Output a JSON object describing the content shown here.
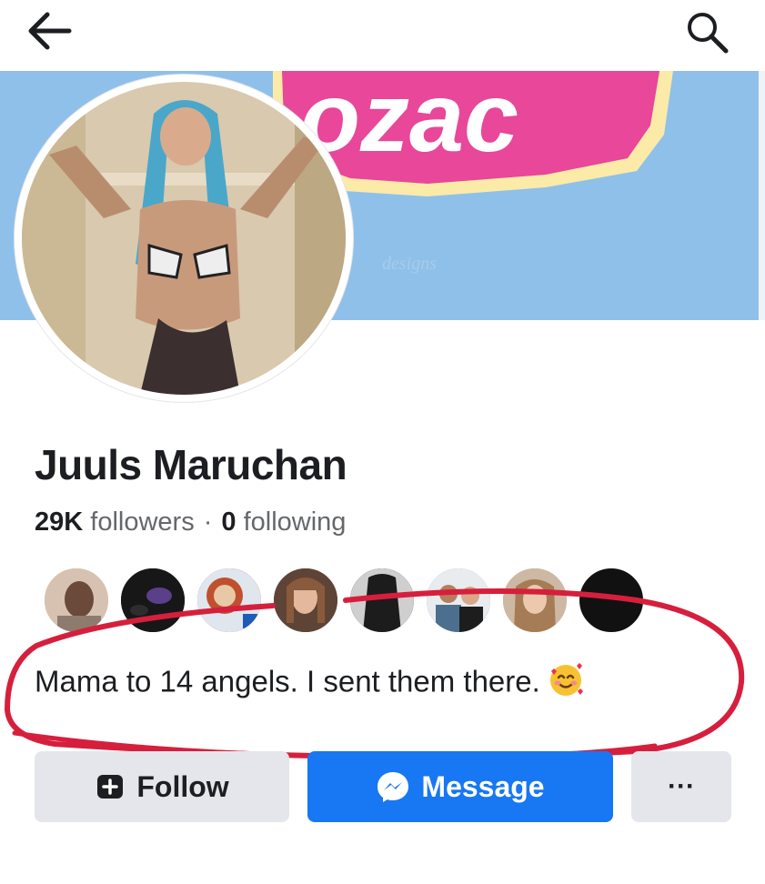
{
  "header": {
    "back_icon": "arrow-left-icon",
    "search_icon": "search-icon"
  },
  "cover": {
    "text": "ozac",
    "watermark": "designs",
    "background_color": "#8fc0ea",
    "accent_color": "#e8479a"
  },
  "profile": {
    "name": "Juuls Maruchan",
    "followers_count": "29K",
    "followers_label": "followers",
    "separator": "·",
    "following_count": "0",
    "following_label": "following",
    "bio_text": "Mama to 14 angels. I sent them there.",
    "bio_emoji": "smiling-face-with-hearts-icon"
  },
  "mutual_friends": {
    "count_visible": 8,
    "more_label": "···"
  },
  "actions": {
    "follow_label": "Follow",
    "message_label": "Message",
    "more_label": "···"
  },
  "annotation": {
    "color": "#d61f3c"
  }
}
